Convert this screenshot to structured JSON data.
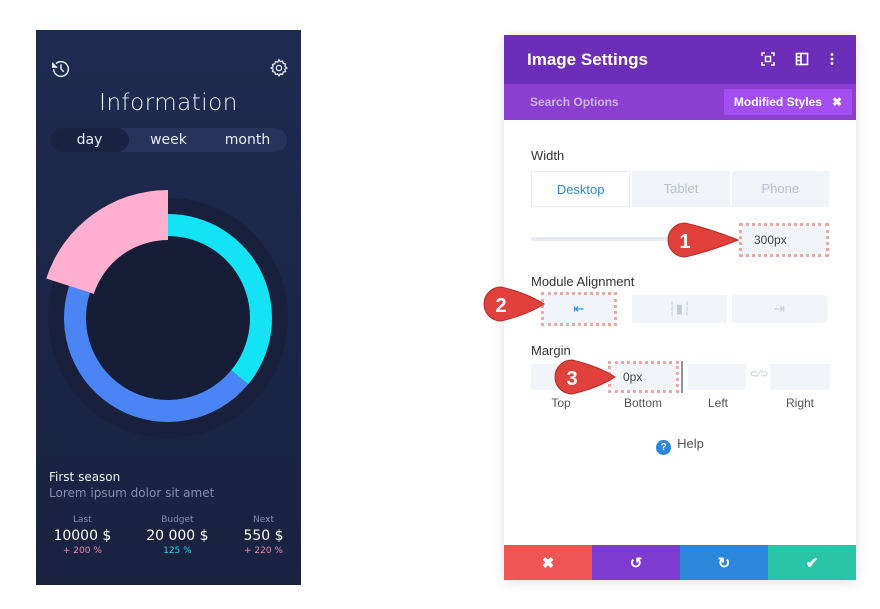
{
  "phone": {
    "history_icon": "history-icon",
    "settings_icon": "gear-icon",
    "title": "Information",
    "periods": [
      "day",
      "week",
      "month"
    ],
    "active_period": "day",
    "chart_data": {
      "type": "pie",
      "variant": "donut",
      "segments": [
        {
          "name": "cyan",
          "value": 36,
          "color": "#14e2f5"
        },
        {
          "name": "blue",
          "value": 44,
          "color": "#4a84f5"
        },
        {
          "name": "pink",
          "value": 20,
          "color": "#ffb0d0"
        }
      ]
    },
    "season_title": "First season",
    "season_desc": "Lorem ipsum dolor sit amet",
    "stats": [
      {
        "label": "Last",
        "value": "10000 $",
        "change": "+ 200 %",
        "color": "#f08bb2"
      },
      {
        "label": "Budget",
        "value": "20 000 $",
        "change": "125 %",
        "color": "#22d3e6"
      },
      {
        "label": "Next",
        "value": "550 $",
        "change": "+ 220 %",
        "color": "#f08bb2"
      }
    ]
  },
  "panel": {
    "title": "Image Settings",
    "header_icons": [
      "expand-icon",
      "sidebar-layout-icon",
      "more-vertical-icon"
    ],
    "search_label": "Search Options",
    "modified_label": "Modified Styles",
    "modified_close": "✖",
    "width_label": "Width",
    "device_tabs": [
      "Desktop",
      "Tablet",
      "Phone"
    ],
    "active_device": "Desktop",
    "width_value": "300px",
    "alignment_label": "Module Alignment",
    "alignment_options": [
      "left",
      "center",
      "right"
    ],
    "active_alignment": "left",
    "margin_label": "Margin",
    "margin_fields": [
      {
        "label": "Top",
        "value": ""
      },
      {
        "label": "Bottom",
        "value": "0px"
      },
      {
        "label": "Left",
        "value": ""
      },
      {
        "label": "Right",
        "value": ""
      }
    ],
    "link_icon": "link-icon",
    "help_label": "Help",
    "footer_buttons": [
      {
        "name": "cancel",
        "glyph": "✖",
        "color": "#ef5555"
      },
      {
        "name": "undo",
        "glyph": "↺",
        "color": "#7d3bcf"
      },
      {
        "name": "redo",
        "glyph": "↻",
        "color": "#2b87da"
      },
      {
        "name": "save",
        "glyph": "✔",
        "color": "#29c4a9"
      }
    ]
  },
  "annotations": [
    "1",
    "2",
    "3"
  ]
}
